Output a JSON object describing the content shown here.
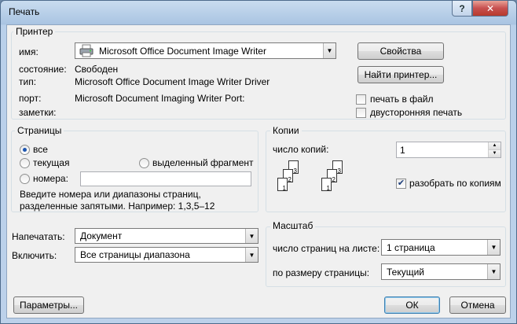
{
  "window": {
    "title": "Печать",
    "help_label": "?",
    "close_label": "✕"
  },
  "printer": {
    "group_label": "Принтер",
    "name_label": "имя:",
    "name_value": "Microsoft Office Document Image Writer",
    "status_label": "состояние:",
    "status_value": "Свободен",
    "type_label": "тип:",
    "type_value": "Microsoft Office Document Image Writer Driver",
    "port_label": "порт:",
    "port_value": "Microsoft Document Imaging Writer Port:",
    "notes_label": "заметки:",
    "properties_button": "Свойства",
    "find_button": "Найти принтер...",
    "print_to_file": "печать в файл",
    "print_to_file_checked": false,
    "duplex": "двусторонняя печать",
    "duplex_checked": false
  },
  "pages": {
    "group_label": "Страницы",
    "all": "все",
    "current": "текущая",
    "selection": "выделенный фрагмент",
    "numbers": "номера:",
    "numbers_value": "",
    "selected": "all",
    "hint": "Введите номера или диапазоны страниц, разделенные запятыми. Например: 1,3,5–12"
  },
  "copies": {
    "group_label": "Копии",
    "count_label": "число копий:",
    "count_value": "1",
    "collate": "разобрать по копиям",
    "collate_checked": true,
    "collated_pages": [
      "1",
      "2",
      "3"
    ],
    "uncollated_pages": [
      "1",
      "2",
      "3"
    ]
  },
  "print_what": {
    "label": "Напечатать:",
    "value": "Документ"
  },
  "include": {
    "label": "Включить:",
    "value": "Все страницы диапазона"
  },
  "scale": {
    "group_label": "Масштаб",
    "pages_per_sheet_label": "число страниц на листе:",
    "pages_per_sheet_value": "1 страница",
    "fit_label": "по размеру страницы:",
    "fit_value": "Текущий"
  },
  "footer": {
    "options_button": "Параметры...",
    "ok_button": "ОК",
    "cancel_button": "Отмена"
  },
  "icons": {
    "printer": "printer-icon",
    "dropdown": "chevron-down-icon",
    "check": "checkmark-icon"
  },
  "colors": {
    "client_bg": "#f0f0f0",
    "close_red": "#c75050",
    "frame_blue": "#a9c4e2"
  }
}
